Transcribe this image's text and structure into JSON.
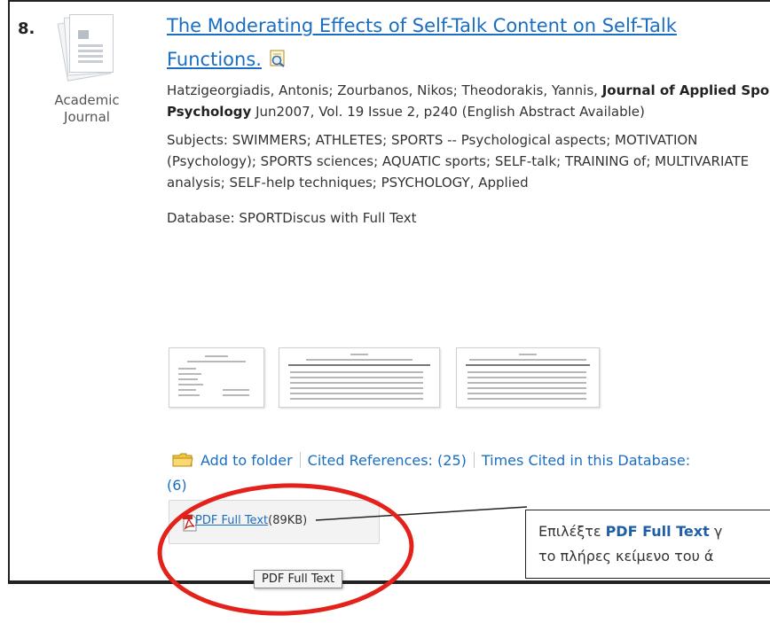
{
  "result": {
    "number": "8.",
    "type_label": "Academic Journal",
    "type_icon": "journal-icon",
    "title": "The Moderating Effects of Self-Talk Content on Self-Talk Functions.",
    "preview_icon": "magnifier-preview-icon",
    "authors": "Hatzigeorgiadis, Antonis; Zourbanos, Nikos; Theodorakis, Yannis,",
    "journal": "Journal of Applied Sport Psychology",
    "citation": "Jun2007, Vol. 19 Issue 2, p240 (English Abstract Available)",
    "subjects": "Subjects: SWIMMERS; ATHLETES; SPORTS -- Psychological aspects; MOTIVATION (Psychology); SPORTS sciences; AQUATIC sports; SELF-talk; TRAINING of; MULTIVARIATE analysis; SELF-help techniques; PSYCHOLOGY, Applied",
    "database": "Database: SPORTDiscus with Full Text"
  },
  "actions": {
    "add_to_folder": "Add to folder",
    "cited_references": "Cited References: (25)",
    "times_cited": "Times Cited in this Database:",
    "times_cited_count": "(6)",
    "folder_icon": "folder-icon"
  },
  "pdf": {
    "icon": "pdf-icon",
    "label": "PDF Full Text",
    "size": "(89KB)",
    "tooltip": "PDF Full Text"
  },
  "callout": {
    "prefix": "Επιλέξτε ",
    "highlight": "PDF Full Text",
    "line1_rest": " γ",
    "line2": "το πλήρες κείμενο του ά"
  },
  "colors": {
    "link": "#1a6ec2",
    "annotation_circle": "#e3221b",
    "callout_highlight": "#1f5fa8"
  }
}
